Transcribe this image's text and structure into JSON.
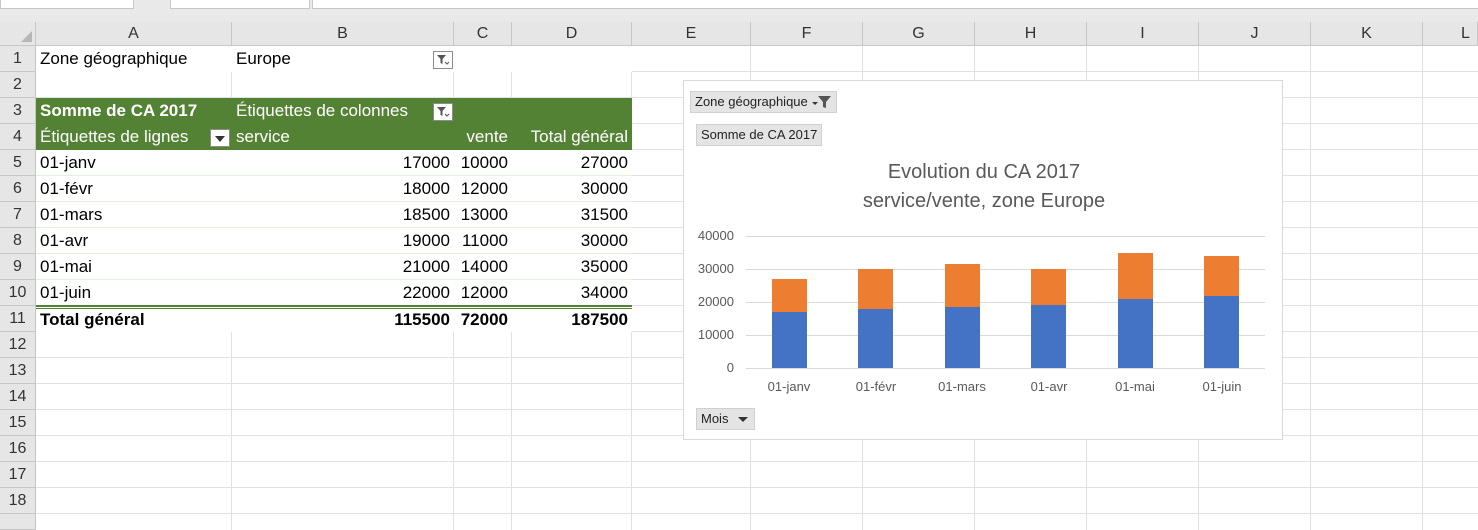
{
  "columns": [
    "A",
    "B",
    "C",
    "D",
    "E",
    "F",
    "G",
    "H",
    "I",
    "J",
    "K",
    "L"
  ],
  "rows": [
    "1",
    "2",
    "3",
    "4",
    "5",
    "6",
    "7",
    "8",
    "9",
    "10",
    "11",
    "12",
    "13",
    "14",
    "15",
    "16",
    "17",
    "18"
  ],
  "cells": {
    "a1": "Zone géographique",
    "b1": "Europe",
    "a3": "Somme de CA 2017",
    "b3": "Étiquettes de colonnes",
    "a4": "Étiquettes de lignes",
    "b4": "service",
    "c4": "vente",
    "d4": "Total général",
    "data_rows": [
      {
        "label": "01-janv",
        "service": "17000",
        "vente": "10000",
        "total": "27000"
      },
      {
        "label": "01-févr",
        "service": "18000",
        "vente": "12000",
        "total": "30000"
      },
      {
        "label": "01-mars",
        "service": "18500",
        "vente": "13000",
        "total": "31500"
      },
      {
        "label": "01-avr",
        "service": "19000",
        "vente": "11000",
        "total": "30000"
      },
      {
        "label": "01-mai",
        "service": "21000",
        "vente": "14000",
        "total": "35000"
      },
      {
        "label": "01-juin",
        "service": "22000",
        "vente": "12000",
        "total": "34000"
      }
    ],
    "total_label": "Total général",
    "total_service": "115500",
    "total_vente": "72000",
    "total_total": "187500"
  },
  "chart_buttons": {
    "zone": "Zone géographique",
    "sum": "Somme de CA 2017",
    "mois": "Mois"
  },
  "colors": {
    "pivot_header": "#548235",
    "service": "#4472c4",
    "vente": "#ed7d31"
  },
  "chart_data": {
    "type": "bar",
    "stacked": true,
    "title": "Evolution du CA 2017",
    "subtitle": "service/vente, zone Europe",
    "categories": [
      "01-janv",
      "01-févr",
      "01-mars",
      "01-avr",
      "01-mai",
      "01-juin"
    ],
    "series": [
      {
        "name": "service",
        "values": [
          17000,
          18000,
          18500,
          19000,
          21000,
          22000
        ]
      },
      {
        "name": "vente",
        "values": [
          10000,
          12000,
          13000,
          11000,
          14000,
          12000
        ]
      }
    ],
    "yticks": [
      "0",
      "10000",
      "20000",
      "30000",
      "40000"
    ],
    "ylim": [
      0,
      40000
    ],
    "grid": true
  }
}
